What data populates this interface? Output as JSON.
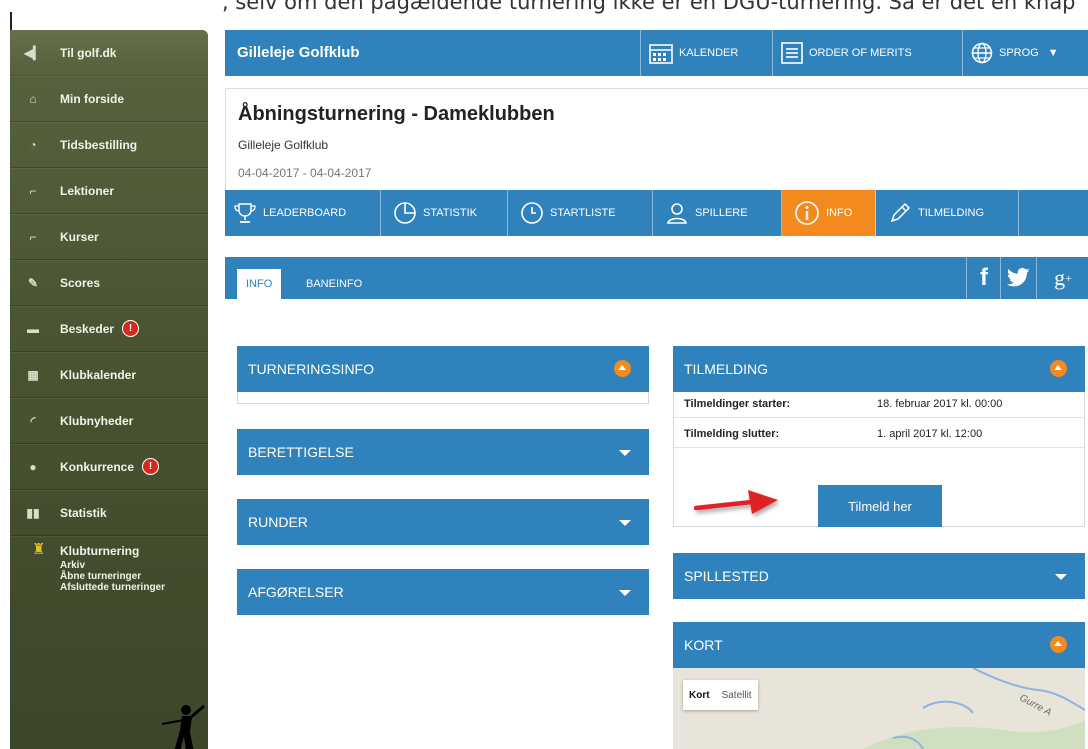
{
  "top_strip": {
    "cut_text": ", selv om den pågældende turnering ikke er en DGU-turnering. Så er det en knap"
  },
  "sidebar": {
    "items": [
      {
        "label": "Til golf.dk"
      },
      {
        "label": "Min forside"
      },
      {
        "label": "Tidsbestilling"
      },
      {
        "label": "Lektioner"
      },
      {
        "label": "Kurser"
      },
      {
        "label": "Scores"
      },
      {
        "label": "Beskeder",
        "badge": "!"
      },
      {
        "label": "Klubkalender"
      },
      {
        "label": "Klubnyheder"
      },
      {
        "label": "Konkurrence",
        "badge": "!"
      },
      {
        "label": "Statistik"
      }
    ],
    "klubturnering": {
      "label": "Klubturnering",
      "subitems": [
        "Arkiv",
        "Åbne turneringer",
        "Afsluttede turneringer"
      ]
    }
  },
  "topbar": {
    "club_name": "Gilleleje Golfklub",
    "buttons": [
      "KALENDER",
      "ORDER OF MERITS",
      "SPROG"
    ]
  },
  "tournament": {
    "title": "Åbningsturnering - Dameklubben",
    "club": "Gilleleje Golfklub",
    "dates": "04-04-2017 - 04-04-2017"
  },
  "tabs": [
    "LEADERBOARD",
    "STATISTIK",
    "STARTLISTE",
    "SPILLERE",
    "INFO",
    "TILMELDING"
  ],
  "subtabs": [
    "INFO",
    "BANEINFO"
  ],
  "left_sections": [
    "TURNERINGSINFO",
    "BERETTIGELSE",
    "RUNDER",
    "AFGØRELSER"
  ],
  "tilmelding": {
    "title": "TILMELDING",
    "rows": [
      {
        "key": "Tilmeldinger starter:",
        "value": "18. februar 2017 kl. 00:00"
      },
      {
        "key": "Tilmelding slutter:",
        "value": "1. april 2017 kl. 12:00"
      }
    ],
    "button": "Tilmeld her"
  },
  "spillested": {
    "title": "SPILLESTED"
  },
  "kort": {
    "title": "KORT",
    "controls": [
      "Kort",
      "Satellit"
    ],
    "place_label": "Gurre A"
  },
  "colors": {
    "primary_blue": "#2f82bc",
    "accent_orange": "#f28a1e",
    "sidebar_olive": "#4a5533",
    "arrow_red": "#e02020"
  }
}
